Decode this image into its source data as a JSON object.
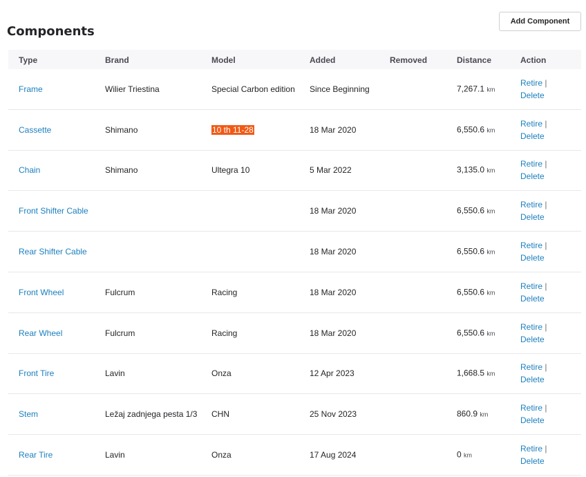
{
  "page": {
    "title": "Components",
    "add_button": "Add Component"
  },
  "table": {
    "headers": {
      "type": "Type",
      "brand": "Brand",
      "model": "Model",
      "added": "Added",
      "removed": "Removed",
      "distance": "Distance",
      "action": "Action"
    },
    "action_labels": {
      "retire": "Retire",
      "separator": "|",
      "delete": "Delete"
    },
    "rows": [
      {
        "type": "Frame",
        "brand": "Wilier Triestina",
        "model": "Special Carbon edition",
        "added": "Since Beginning",
        "removed": "",
        "distance": "7,267.1",
        "unit": "km"
      },
      {
        "type": "Cassette",
        "brand": "Shimano",
        "model": "10 th 11-28",
        "model_highlighted": true,
        "added": "18 Mar 2020",
        "removed": "",
        "distance": "6,550.6",
        "unit": "km"
      },
      {
        "type": "Chain",
        "brand": "Shimano",
        "model": "Ultegra 10",
        "added": "5 Mar 2022",
        "removed": "",
        "distance": "3,135.0",
        "unit": "km"
      },
      {
        "type": "Front Shifter Cable",
        "brand": "",
        "model": "",
        "added": "18 Mar 2020",
        "removed": "",
        "distance": "6,550.6",
        "unit": "km"
      },
      {
        "type": "Rear Shifter Cable",
        "brand": "",
        "model": "",
        "added": "18 Mar 2020",
        "removed": "",
        "distance": "6,550.6",
        "unit": "km"
      },
      {
        "type": "Front Wheel",
        "brand": "Fulcrum",
        "model": "Racing",
        "added": "18 Mar 2020",
        "removed": "",
        "distance": "6,550.6",
        "unit": "km"
      },
      {
        "type": "Rear Wheel",
        "brand": "Fulcrum",
        "model": "Racing",
        "added": "18 Mar 2020",
        "removed": "",
        "distance": "6,550.6",
        "unit": "km"
      },
      {
        "type": "Front Tire",
        "brand": "Lavin",
        "model": "Onza",
        "added": "12 Apr 2023",
        "removed": "",
        "distance": "1,668.5",
        "unit": "km"
      },
      {
        "type": "Stem",
        "brand": "Ležaj zadnjega pesta 1/3",
        "model": "CHN",
        "added": "25 Nov 2023",
        "removed": "",
        "distance": "860.9",
        "unit": "km"
      },
      {
        "type": "Rear Tire",
        "brand": "Lavin",
        "model": "Onza",
        "added": "17 Aug 2024",
        "removed": "",
        "distance": "0",
        "unit": "km"
      }
    ]
  },
  "colors": {
    "link": "#1b7fbe",
    "highlight": "#f05a16",
    "header_bg": "#f7f7fa"
  }
}
